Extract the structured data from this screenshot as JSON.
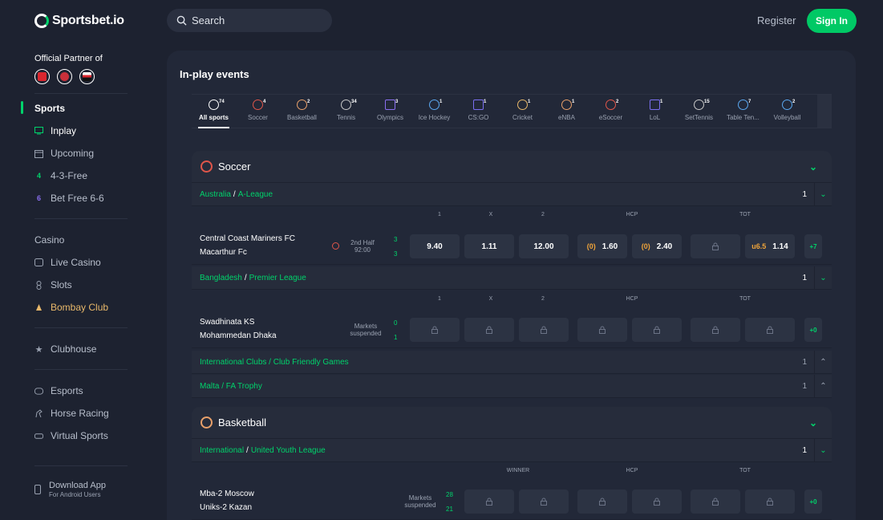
{
  "header": {
    "logo": "Sportsbet.io",
    "search_placeholder": "Search",
    "register": "Register",
    "signin": "Sign In"
  },
  "sidebar": {
    "partner_label": "Official Partner of",
    "sports_head": "Sports",
    "sports_items": [
      "Inplay",
      "Upcoming",
      "4-3-Free",
      "Bet Free 6-6"
    ],
    "casino_head": "Casino",
    "casino_items": [
      "Live Casino",
      "Slots",
      "Bombay Club"
    ],
    "clubhouse": "Clubhouse",
    "other_items": [
      "Esports",
      "Horse Racing",
      "Virtual Sports"
    ],
    "download": {
      "title": "Download App",
      "subtitle": "For Android Users"
    }
  },
  "main": {
    "title": "In-play events",
    "tabs": [
      {
        "label": "All sports",
        "count": "74"
      },
      {
        "label": "Soccer",
        "count": "4"
      },
      {
        "label": "Basketball",
        "count": "2"
      },
      {
        "label": "Tennis",
        "count": "34"
      },
      {
        "label": "Olympics",
        "count": "3"
      },
      {
        "label": "Ice Hockey",
        "count": "1"
      },
      {
        "label": "CS:GO",
        "count": "1"
      },
      {
        "label": "Cricket",
        "count": "1"
      },
      {
        "label": "eNBA",
        "count": "1"
      },
      {
        "label": "eSoccer",
        "count": "2"
      },
      {
        "label": "LoL",
        "count": "1"
      },
      {
        "label": "SetTennis",
        "count": "15"
      },
      {
        "label": "Table Ten...",
        "count": "7"
      },
      {
        "label": "Volleyball",
        "count": "2"
      }
    ],
    "soccer": {
      "name": "Soccer",
      "leagues": [
        {
          "region": "Australia",
          "league": "A-League",
          "count": "1"
        },
        {
          "region": "Bangladesh",
          "league": "Premier League",
          "count": "1"
        },
        {
          "region": "International Clubs / Club Friendly Games",
          "league": "",
          "count": "1"
        },
        {
          "region": "Malta / FA Trophy",
          "league": "",
          "count": "1"
        }
      ],
      "market_headers": [
        "1",
        "X",
        "2",
        "HCP",
        "TOT"
      ],
      "events": [
        {
          "home": "Central Coast Mariners FC",
          "away": "Macarthur Fc",
          "status1": "2nd Half",
          "status2": "92:00",
          "score_home": "3",
          "score_away": "3",
          "odds": [
            "9.40",
            "1.11",
            "12.00"
          ],
          "hcp": [
            {
              "line": "(0)",
              "odd": "1.60"
            },
            {
              "line": "(0)",
              "odd": "2.40"
            }
          ],
          "tot": {
            "line": "u6.5",
            "odd": "1.14"
          },
          "more": "+7"
        },
        {
          "home": "Swadhinata KS",
          "away": "Mohammedan Dhaka",
          "status1": "Markets",
          "status2": "suspended",
          "score_home": "0",
          "score_away": "1",
          "more": "+0"
        }
      ]
    },
    "basketball": {
      "name": "Basketball",
      "league": {
        "region": "International",
        "league": "United Youth League",
        "count": "1"
      },
      "market_headers": [
        "WINNER",
        "HCP",
        "TOT"
      ],
      "event": {
        "home": "Mba-2 Moscow",
        "away": "Uniks-2 Kazan",
        "status1": "Markets",
        "status2": "suspended",
        "score_home": "28",
        "score_away": "21",
        "more": "+0"
      }
    }
  }
}
